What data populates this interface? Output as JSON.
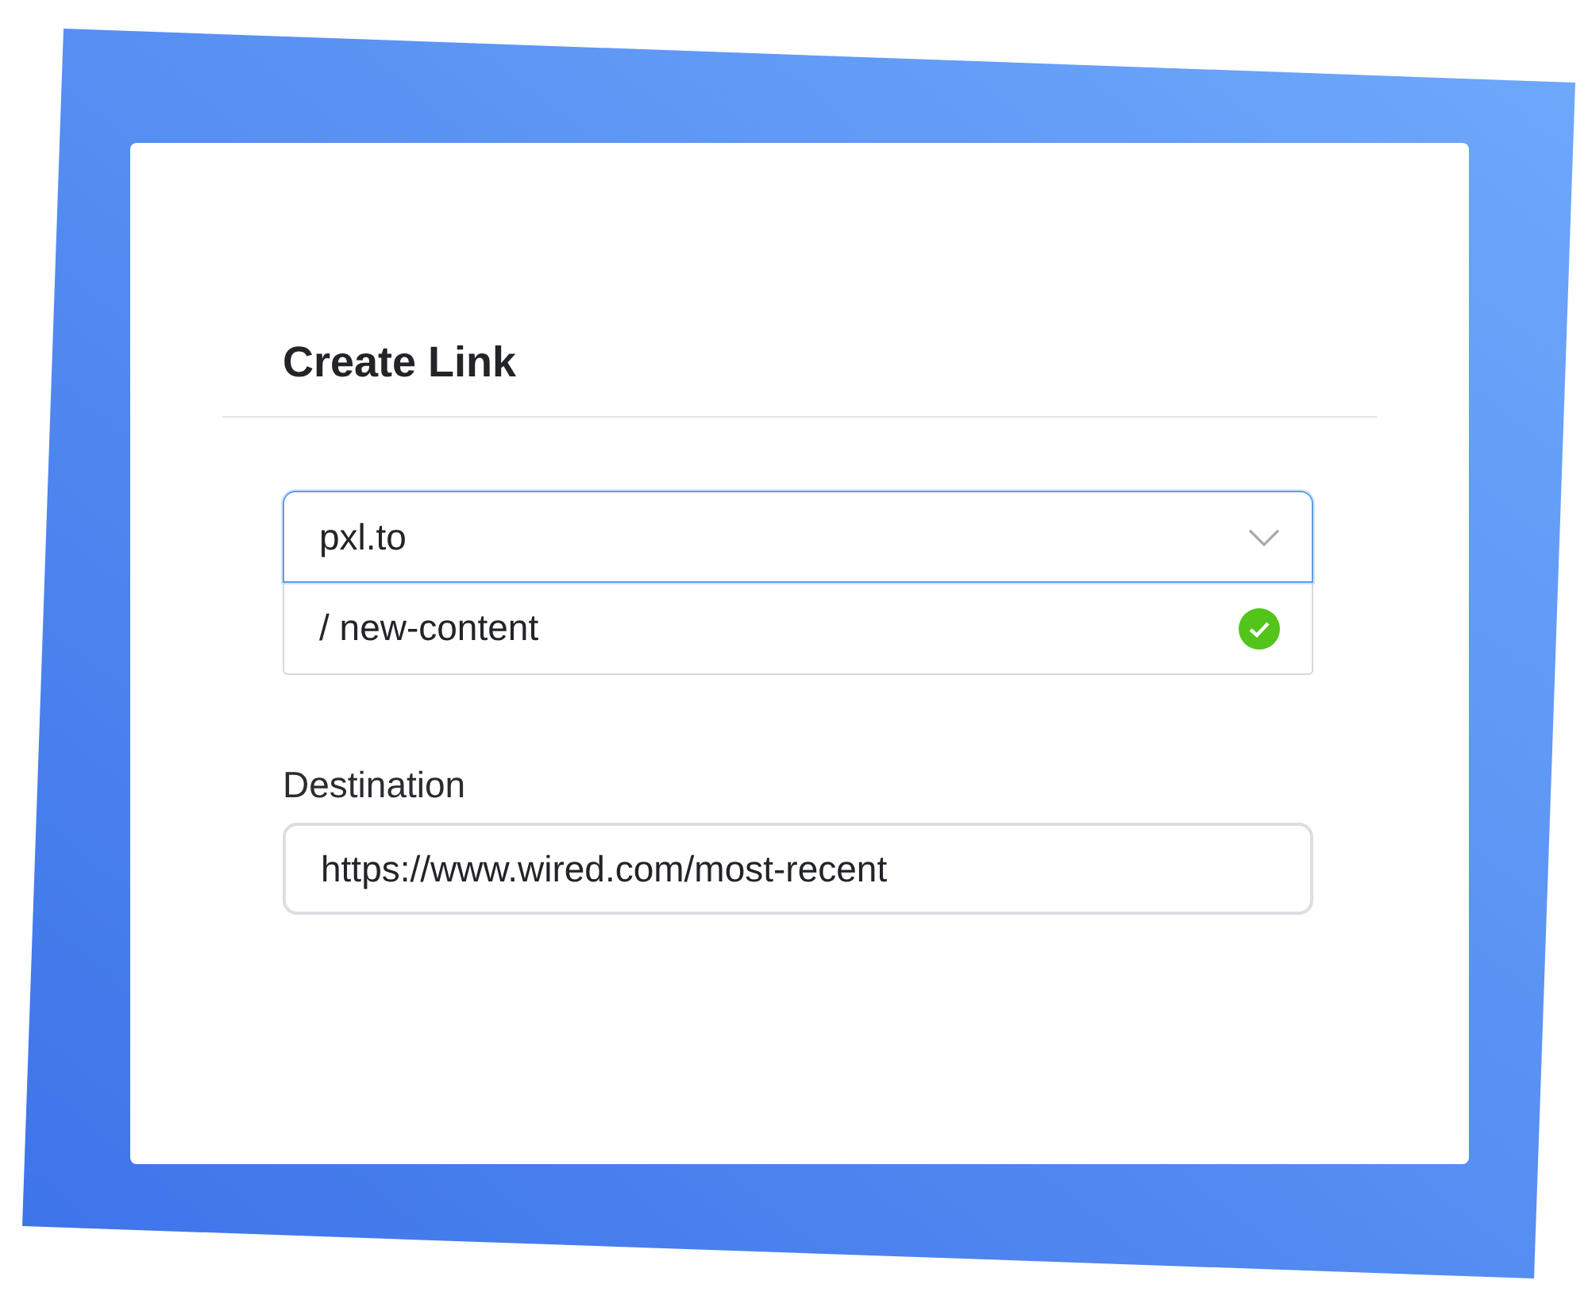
{
  "dialog": {
    "title": "Create Link"
  },
  "domain_select": {
    "value": "pxl.to",
    "focused": true
  },
  "slug_field": {
    "value": "/ new-content",
    "valid": true
  },
  "destination": {
    "label": "Destination",
    "value": "https://www.wired.com/most-recent"
  }
}
